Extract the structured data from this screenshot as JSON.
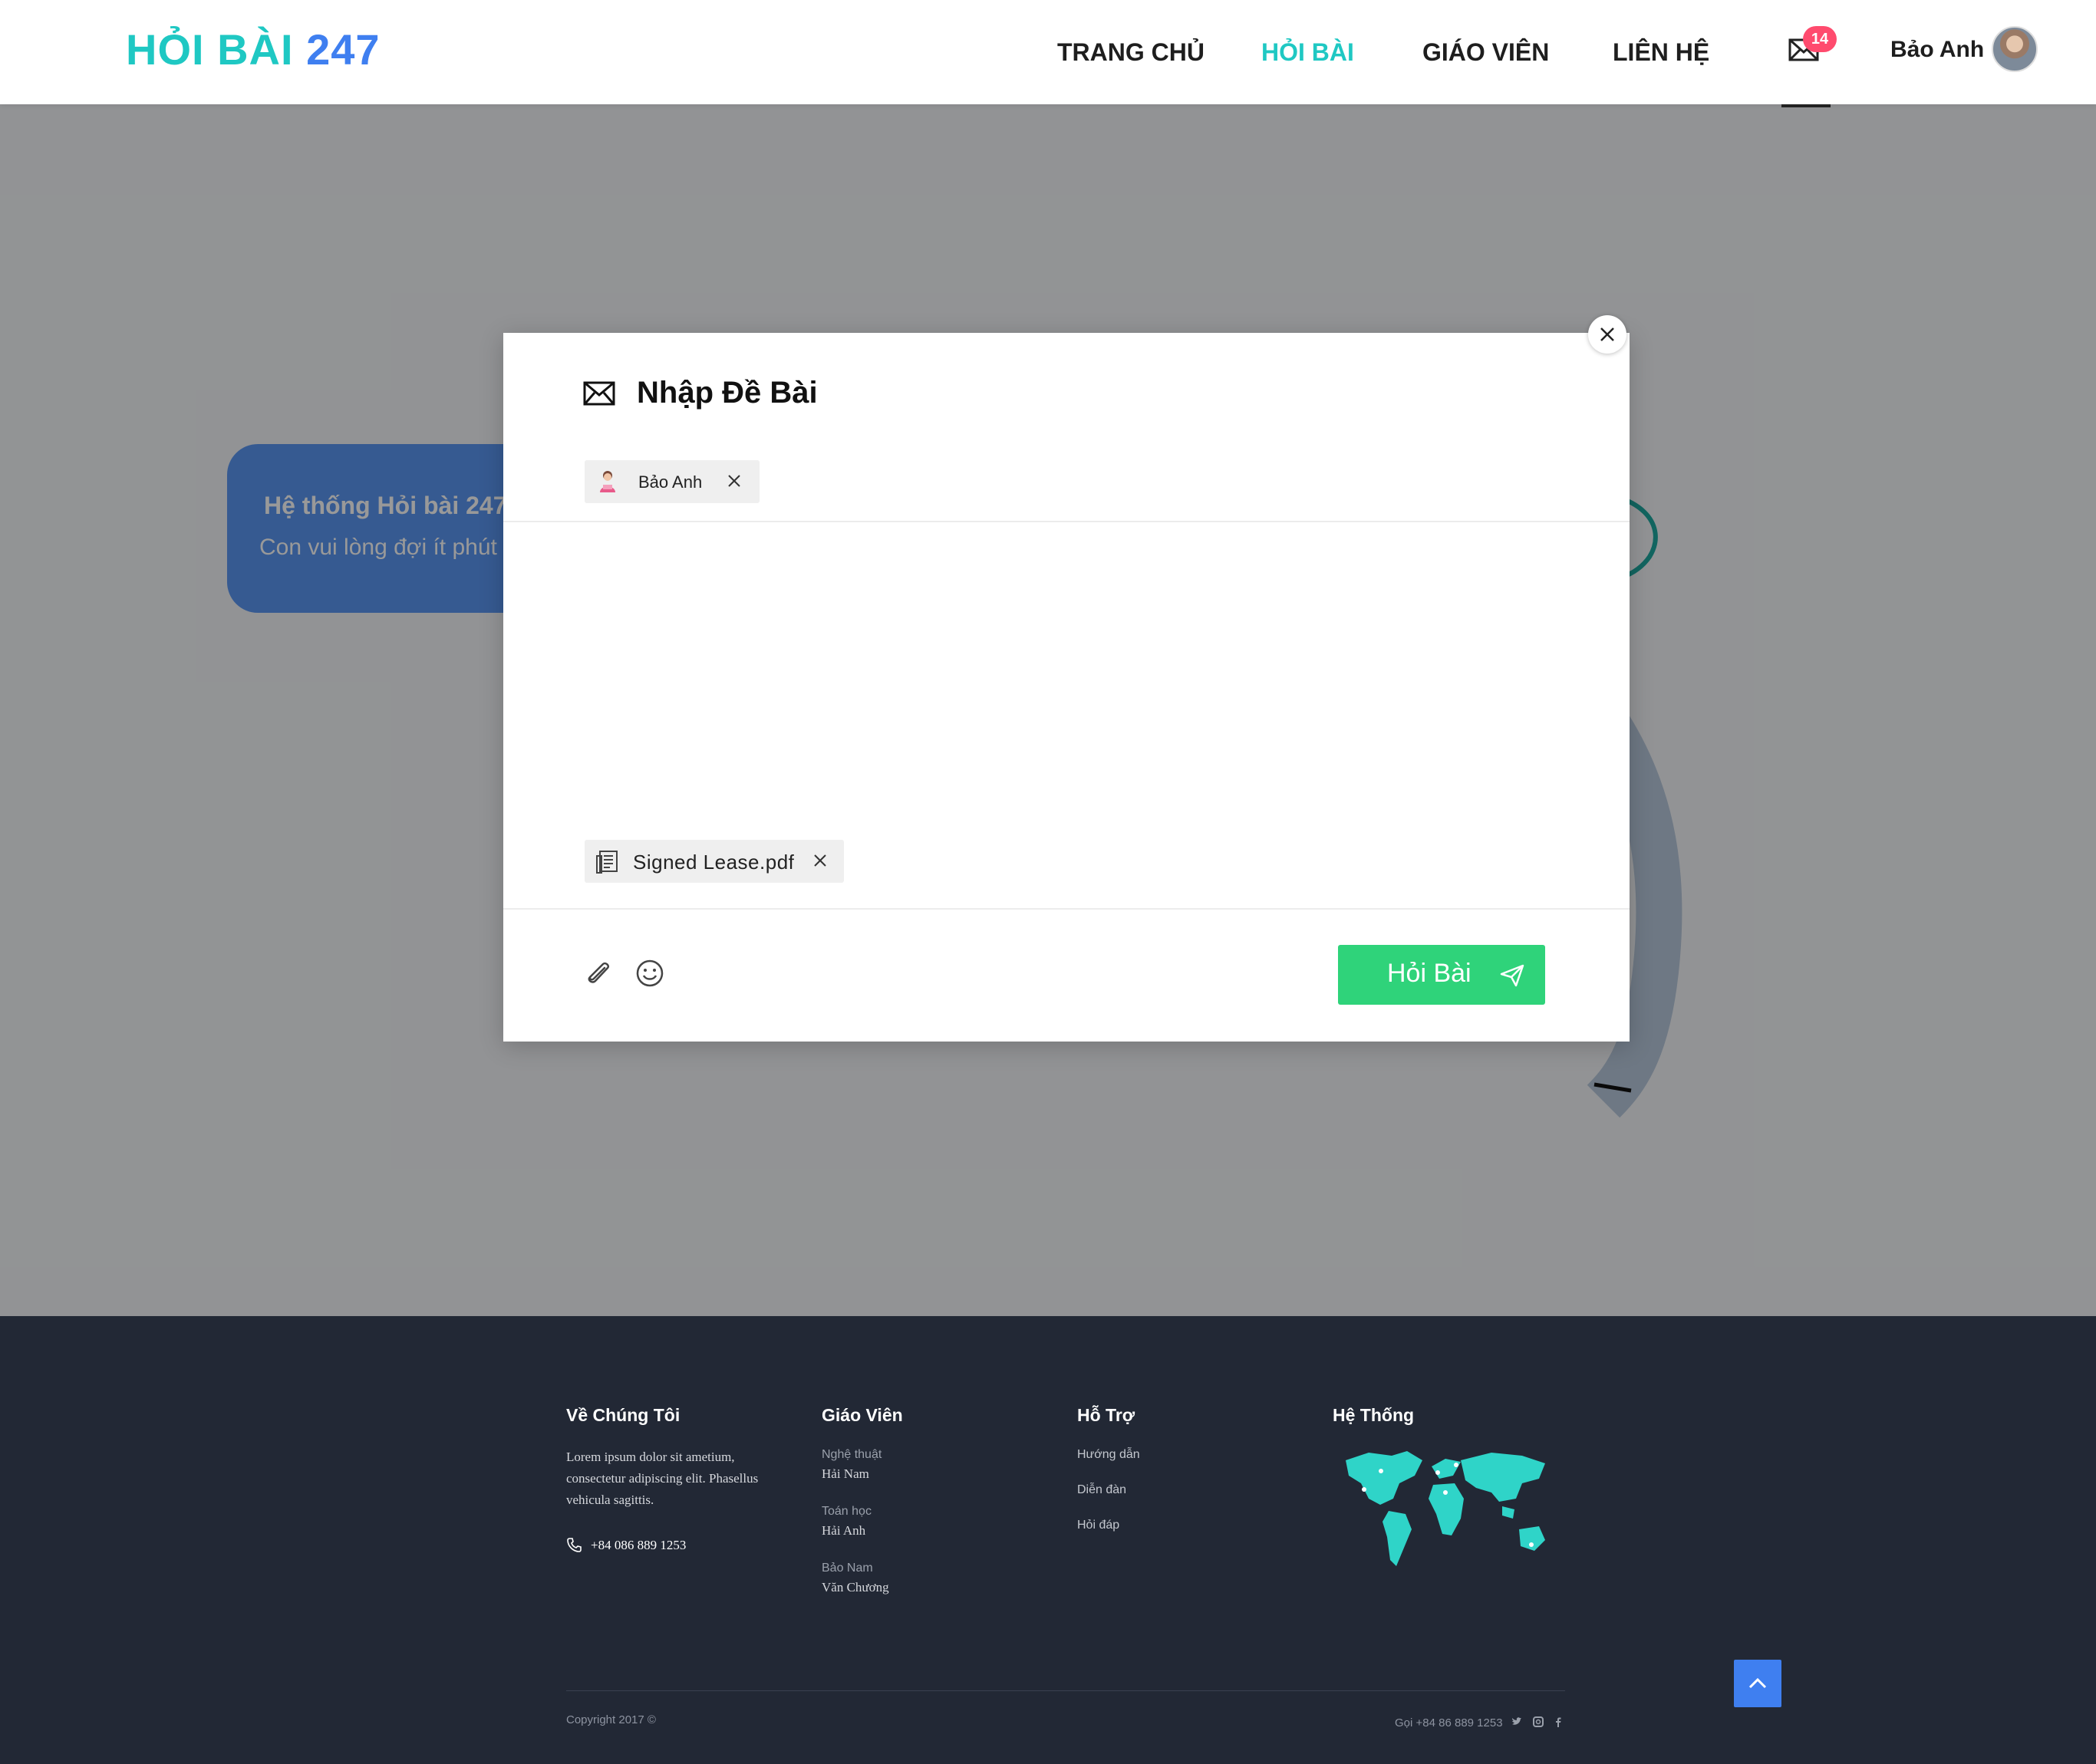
{
  "brand": {
    "part1": "HỎI BÀI",
    "part2": "247"
  },
  "nav": {
    "items": [
      {
        "label": "TRANG CHỦ",
        "active": false
      },
      {
        "label": "HỎI BÀI",
        "active": true
      },
      {
        "label": "GIÁO VIÊN",
        "active": false
      },
      {
        "label": "LIÊN HỆ",
        "active": false
      }
    ],
    "mail_badge": "14",
    "user_name": "Bảo Anh"
  },
  "hero": {
    "title": "Hệ thống Hỏi bài 247",
    "subtitle": "Con vui lòng đợi ít phút"
  },
  "modal": {
    "title": "Nhập Đề Bài",
    "recipient": "Bảo Anh",
    "attachment": "Signed Lease.pdf",
    "submit_label": "Hỏi Bài"
  },
  "footer": {
    "about": {
      "heading": "Về Chúng Tôi",
      "text": "Lorem ipsum dolor sit ametium, consectetur adipiscing elit. Phasellus vehicula sagittis.",
      "phone": "+84 086 889 1253"
    },
    "teachers": {
      "heading": "Giáo Viên",
      "items": [
        {
          "subject": "Nghệ thuật",
          "name": "Hải Nam"
        },
        {
          "subject": "Toán học",
          "name": "Hải Anh"
        },
        {
          "subject": "Bảo Nam",
          "name": "Văn Chương"
        }
      ]
    },
    "support": {
      "heading": "Hỗ Trợ",
      "links": [
        "Hướng dẫn",
        "Diễn đàn",
        "Hỏi đáp"
      ]
    },
    "system": {
      "heading": "Hệ Thống"
    },
    "copyright": "Copyright 2017 ©",
    "phone_bottom": "Gọi +84 86 889 1253"
  },
  "colors": {
    "brand_teal": "#1fc8c3",
    "brand_blue": "#3f7ff0",
    "submit_green": "#2fd37a",
    "badge_red": "#ff4b6e",
    "footer_bg": "#222835"
  }
}
